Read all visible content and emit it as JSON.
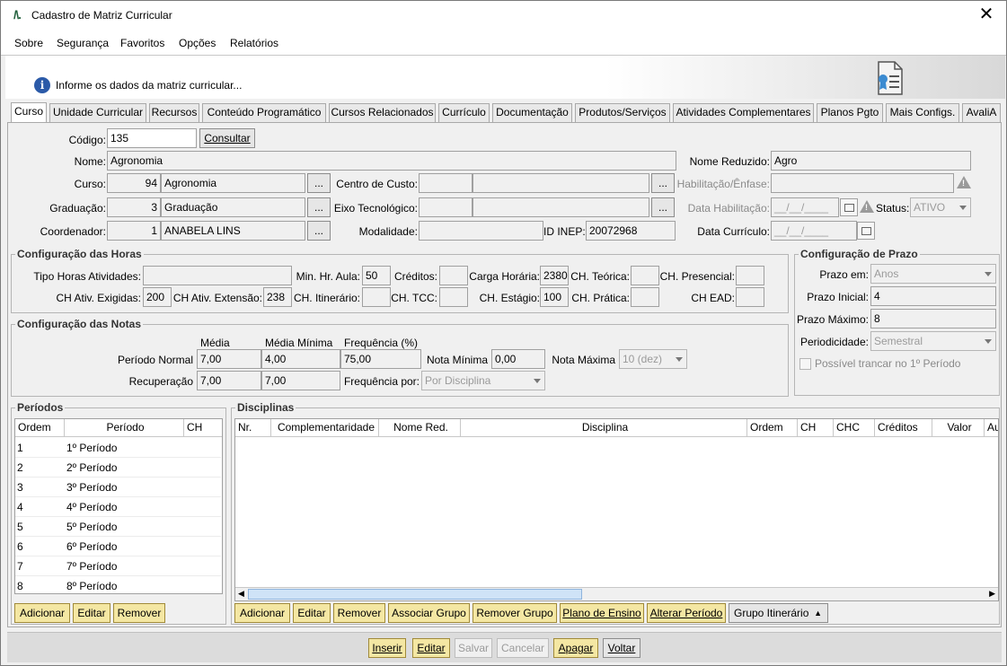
{
  "window": {
    "title": "Cadastro de Matriz Curricular",
    "logo": "/\\."
  },
  "menu": [
    "Sobre",
    "Segurança",
    "Favoritos",
    "Opções",
    "Relatórios"
  ],
  "banner": {
    "message": "Informe os dados da matriz curricular...",
    "info_icon": "info-icon",
    "doc_icon": "certificate-document-icon"
  },
  "tabs": [
    "Curso",
    "Unidade Curricular",
    "Recursos",
    "Conteúdo Programático",
    "Cursos Relacionados",
    "Currículo",
    "Documentação",
    "Produtos/Serviços",
    "Atividades Complementares",
    "Planos Pgto",
    "Mais Configs.",
    "AvaliA"
  ],
  "curso": {
    "codigo_label": "Código:",
    "codigo": "135",
    "consultar": "Consultar",
    "nome_label": "Nome:",
    "nome": "Agronomia",
    "nome_reduzido_label": "Nome Reduzido:",
    "nome_reduzido": "Agro",
    "curso_label": "Curso:",
    "curso_id": "94",
    "curso_nome": "Agronomia",
    "centro_custo_label": "Centro de Custo:",
    "habilitacao_label": "Habilitação/Ênfase:",
    "graduacao_label": "Graduação:",
    "graduacao_id": "3",
    "graduacao_nome": "Graduação",
    "eixo_label": "Eixo Tecnológico:",
    "data_hab_label": "Data Habilitação:",
    "data_hab": "__/__/____",
    "status_label": "Status:",
    "status": "ATIVO",
    "coordenador_label": "Coordenador:",
    "coordenador_id": "1",
    "coordenador_nome": "ANABELA LINS",
    "modalidade_label": "Modalidade:",
    "id_inep_label": "ID INEP:",
    "id_inep": "20072968",
    "data_curriculo_label": "Data Currículo:",
    "data_curriculo": "__/__/____",
    "ellipsis": "..."
  },
  "horas": {
    "title": "Configuração das Horas",
    "tipo_label": "Tipo Horas Atividades:",
    "tipo": "",
    "min_hr_label": "Min. Hr. Aula:",
    "min_hr": "50",
    "creditos_label": "Créditos:",
    "creditos": "",
    "carga_label": "Carga Horária:",
    "carga": "2380",
    "ch_teorica_label": "CH. Teórica:",
    "ch_teorica": "",
    "ch_presencial_label": "CH. Presencial:",
    "ch_presencial": "",
    "ch_ativ_exig_label": "CH Ativ. Exigidas:",
    "ch_ativ_exig": "200",
    "ch_ativ_ext_label": "CH Ativ. Extensão:",
    "ch_ativ_ext": "238",
    "ch_itinerario_label": "CH. Itinerário:",
    "ch_itinerario": "",
    "ch_tcc_label": "CH. TCC:",
    "ch_tcc": "",
    "ch_estagio_label": "CH. Estágio:",
    "ch_estagio": "100",
    "ch_pratica_label": "CH. Prática:",
    "ch_pratica": "",
    "ch_ead_label": "CH EAD:",
    "ch_ead": ""
  },
  "prazo": {
    "title": "Configuração de Prazo",
    "prazo_em_label": "Prazo em:",
    "prazo_em": "Anos",
    "prazo_inicial_label": "Prazo Inicial:",
    "prazo_inicial": "4",
    "prazo_maximo_label": "Prazo Máximo:",
    "prazo_maximo": "8",
    "periodicidade_label": "Periodicidade:",
    "periodicidade": "Semestral",
    "trancar_label": "Possível trancar no 1º Período"
  },
  "notas": {
    "title": "Configuração das Notas",
    "media_h": "Média",
    "media_min_h": "Média Mínima",
    "freq_h": "Frequência (%)",
    "periodo_normal_label": "Período Normal",
    "pn_media": "7,00",
    "pn_media_min": "4,00",
    "pn_freq": "75,00",
    "nota_minima_label": "Nota Mínima",
    "nota_minima": "0,00",
    "nota_maxima_label": "Nota Máxima",
    "nota_maxima": "10 (dez)",
    "recuperacao_label": "Recuperação",
    "rec_media": "7,00",
    "rec_media_min": "7,00",
    "freq_por_label": "Frequência por:",
    "freq_por": "Por Disciplina"
  },
  "periodos": {
    "title": "Períodos",
    "headers": [
      "Ordem",
      "Período",
      "CH"
    ],
    "rows": [
      [
        "1",
        "1º Período",
        ""
      ],
      [
        "2",
        "2º Período",
        ""
      ],
      [
        "3",
        "3º Período",
        ""
      ],
      [
        "4",
        "4º Período",
        ""
      ],
      [
        "5",
        "5º Período",
        ""
      ],
      [
        "6",
        "6º Período",
        ""
      ],
      [
        "7",
        "7º Período",
        ""
      ],
      [
        "8",
        "8º Período",
        ""
      ]
    ],
    "buttons": [
      "Adicionar",
      "Editar",
      "Remover"
    ]
  },
  "disciplinas": {
    "title": "Disciplinas",
    "headers": [
      "Nr.",
      "Complementaridade",
      "Nome Red.",
      "Disciplina",
      "Ordem",
      "CH",
      "CHC",
      "Créditos",
      "Valor",
      "Au"
    ],
    "buttons": [
      "Adicionar",
      "Editar",
      "Remover",
      "Associar Grupo",
      "Remover Grupo",
      "Plano de Ensino",
      "Alterar Período"
    ],
    "grupo_itinerario": "Grupo Itinerário"
  },
  "footer": {
    "buttons": [
      "Inserir",
      "Editar",
      "Salvar",
      "Cancelar",
      "Apagar",
      "Voltar"
    ]
  }
}
